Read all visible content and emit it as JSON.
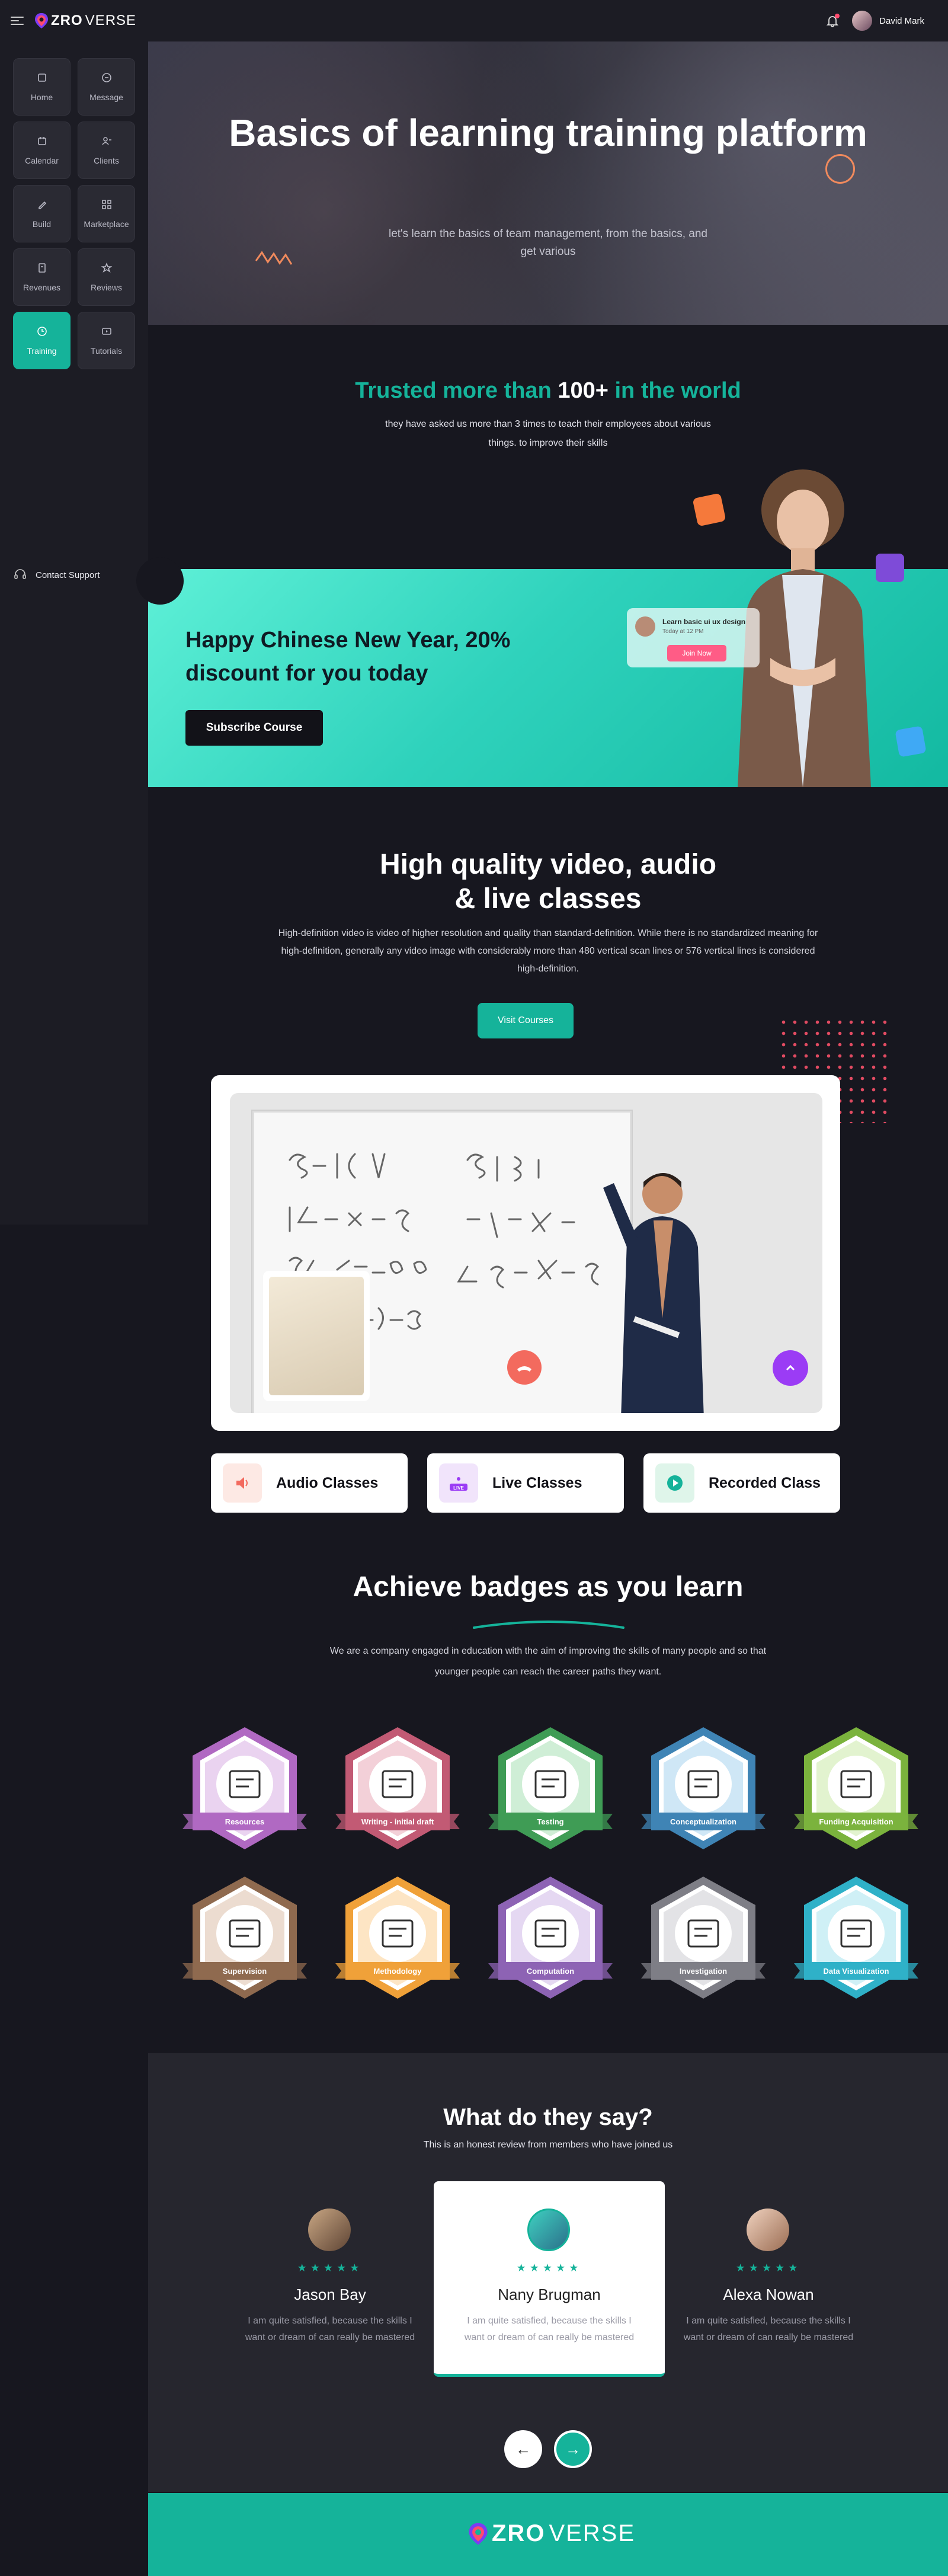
{
  "header": {
    "brand_a": "ZRO",
    "brand_b": "VERSE",
    "user_name": "David Mark"
  },
  "sidebar": {
    "items": [
      {
        "label": "Home",
        "icon": "home-icon"
      },
      {
        "label": "Message",
        "icon": "message-icon"
      },
      {
        "label": "Calendar",
        "icon": "calendar-icon"
      },
      {
        "label": "Clients",
        "icon": "clients-icon"
      },
      {
        "label": "Build",
        "icon": "pencil-icon"
      },
      {
        "label": "Marketplace",
        "icon": "grid-icon"
      },
      {
        "label": "Revenues",
        "icon": "document-icon"
      },
      {
        "label": "Reviews",
        "icon": "star-icon"
      },
      {
        "label": "Training",
        "icon": "clock-icon",
        "active": true
      },
      {
        "label": "Tutorials",
        "icon": "play-icon"
      }
    ],
    "support": "Contact Support"
  },
  "hero": {
    "title": "Basics of learning training platform",
    "subtitle": "let's learn the basics of team management, from the basics, and get various"
  },
  "trusted": {
    "pre": "Trusted more than",
    "num": "100+",
    "post": "in the world",
    "text": "they have asked us more than 3 times to teach their employees about various things. to improve their skills"
  },
  "banner": {
    "title": "Happy Chinese New Year, 20% discount for you today",
    "button": "Subscribe Course",
    "card_title": "Learn basic ui ux design",
    "card_time": "Today at 12 PM",
    "card_button": "Join Now"
  },
  "quality": {
    "title_l1": "High quality video, audio",
    "title_l2": "& live classes",
    "text": "High-definition video is video of higher resolution and quality than standard-definition. While there is no standardized meaning for high-definition, generally any video image with considerably more than 480 vertical scan lines or 576 vertical lines is considered high-definition.",
    "button": "Visit Courses"
  },
  "classes": [
    {
      "label": "Audio Classes",
      "icon": "speaker-icon",
      "bg": "#fde9e4",
      "color": "#f36a5e"
    },
    {
      "label": "Live Classes",
      "icon": "live-icon",
      "bg": "#f1e4fb",
      "color": "#9b3cf5"
    },
    {
      "label": "Recorded Class",
      "icon": "play-circle-icon",
      "bg": "#dff5ea",
      "color": "#15b39a"
    }
  ],
  "badges": {
    "title": "Achieve badges as you learn",
    "text": "We are a company engaged in education with the aim of improving the skills of many people and so that younger people can reach the career paths they want.",
    "items": [
      {
        "label": "Resources",
        "color": "#b069c2",
        "light": "#ead3f0"
      },
      {
        "label": "Writing - initial draft",
        "color": "#c25a74",
        "light": "#f3d0d8"
      },
      {
        "label": "Testing",
        "color": "#3f9c55",
        "light": "#cfeed6"
      },
      {
        "label": "Conceptualization",
        "color": "#3f84b5",
        "light": "#cfe7f6"
      },
      {
        "label": "Funding Acquisition",
        "color": "#7bb33d",
        "light": "#e2f3cf"
      },
      {
        "label": "Supervision",
        "color": "#8f6a4f",
        "light": "#ecdcd0"
      },
      {
        "label": "Methodology",
        "color": "#f0a139",
        "light": "#fde5c4"
      },
      {
        "label": "Computation",
        "color": "#8d63b4",
        "light": "#e5d8f2"
      },
      {
        "label": "Investigation",
        "color": "#7e7e86",
        "light": "#e3e3e6"
      },
      {
        "label": "Data Visualization",
        "color": "#2fb1c8",
        "light": "#cff0f6"
      }
    ]
  },
  "reviews": {
    "title": "What do they say?",
    "subtitle": "This is an honest review from members who have joined us",
    "stars": "★★★★★",
    "items": [
      {
        "name": "Jason Bay",
        "text": "I am quite satisfied, because the skills I want or dream of can really be mastered"
      },
      {
        "name": "Nany Brugman",
        "text": "I am quite satisfied, because the skills I want or dream of can really be mastered"
      },
      {
        "name": "Alexa Nowan",
        "text": "I am quite satisfied, because the skills I want or dream of can really be mastered"
      }
    ],
    "prev": "←",
    "next": "→"
  },
  "footer": {
    "brand_a": "ZRO",
    "brand_b": "VERSE"
  }
}
